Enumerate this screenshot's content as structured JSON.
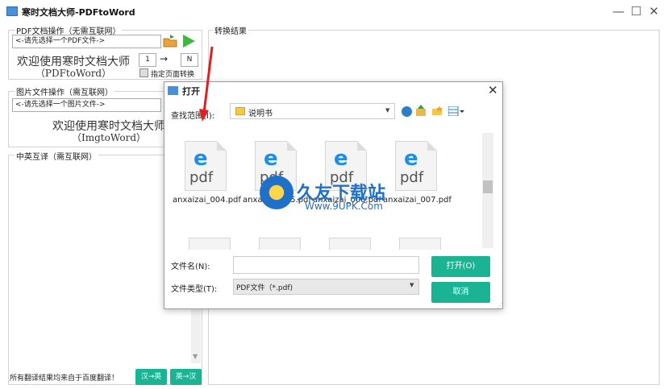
{
  "window": {
    "title": "寒时文档大师-PDFtoWord",
    "min": "—",
    "max": "☐",
    "close": "✕"
  },
  "pdf_group": {
    "title": "PDF文档操作（无需互联网）",
    "combo": "<-请先选择一个PDF文件->",
    "welcome": "欢迎使用寒时文档大师",
    "sub": "（PDFtoWord）",
    "page_from": "1",
    "arrow": "→",
    "page_to": "N",
    "checkbox_label": "指定页面转换"
  },
  "img_group": {
    "title": "图片文件操作（需互联网）",
    "combo": "<-请先选择一个图片文件->",
    "welcome": "欢迎使用寒时文档大师",
    "sub": "（ImgtoWord）"
  },
  "translate_group": {
    "title": "中英互译（需互联网）",
    "footer": "所有翻译结果均来自于百度翻译！",
    "btn_cn_en": "汉→英",
    "btn_en_cn": "英→汉"
  },
  "result_group": {
    "title": "转换结果"
  },
  "dialog": {
    "title": "打开",
    "lookin_label": "查找范围(I):",
    "lookin_value": "说明书",
    "files": [
      {
        "name": "anxaizai_004.pdf"
      },
      {
        "name": "anxaizai_005.pdf"
      },
      {
        "name": "anxaizai_006.pdf"
      },
      {
        "name": "anxaizai_007.pdf"
      }
    ],
    "filename_label": "文件名(N):",
    "filename_value": "",
    "filetype_label": "文件类型(T):",
    "filetype_value": "PDF文件（*.pdf)",
    "open_btn": "打开(O)",
    "cancel_btn": "取消"
  },
  "watermark": {
    "text": "久友下载站",
    "url": "Www.9UPK.Com"
  },
  "colors": {
    "accent_green": "#1ab394",
    "arrow_red": "#e02020"
  }
}
